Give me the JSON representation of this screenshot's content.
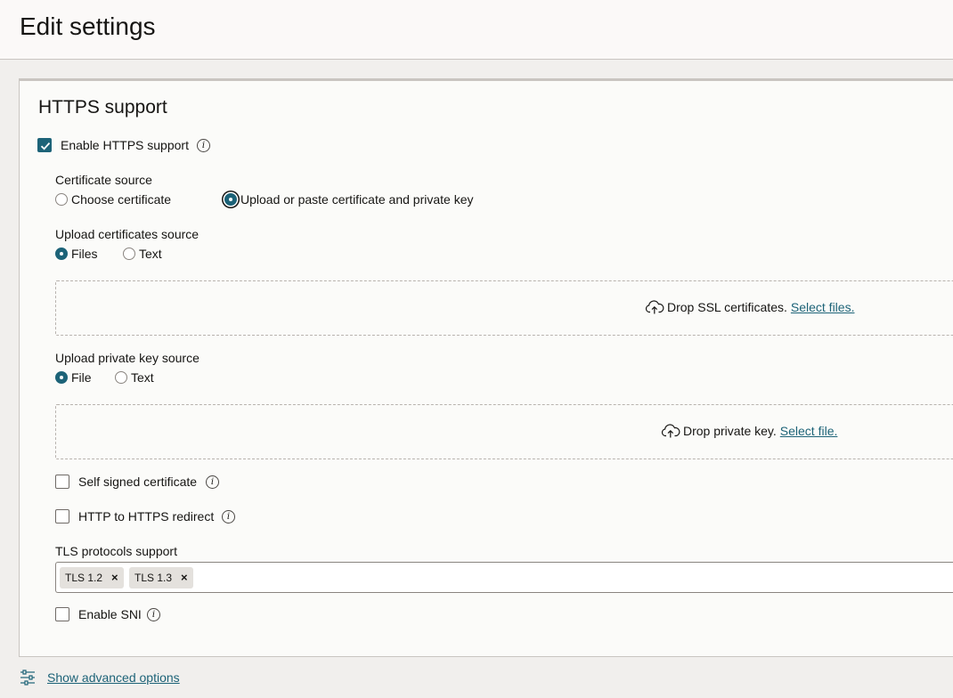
{
  "page": {
    "title": "Edit settings"
  },
  "section": {
    "title": "HTTPS support",
    "enable_https": {
      "label": "Enable HTTPS support",
      "checked": true
    }
  },
  "certificate_source": {
    "label": "Certificate source",
    "options": [
      "Choose certificate",
      "Upload or paste certificate and private key"
    ],
    "selected": "Upload or paste certificate and private key"
  },
  "upload_certificates_source": {
    "label": "Upload certificates source",
    "options": [
      "Files",
      "Text"
    ],
    "selected": "Files"
  },
  "ssl_dropzone": {
    "text": "Drop SSL certificates.",
    "link": "Select files."
  },
  "upload_private_key_source": {
    "label": "Upload private key source",
    "options": [
      "File",
      "Text"
    ],
    "selected": "File"
  },
  "key_dropzone": {
    "text": "Drop private key.",
    "link": "Select file."
  },
  "self_signed": {
    "label": "Self signed certificate",
    "checked": false
  },
  "http_redirect": {
    "label": "HTTP to HTTPS redirect",
    "checked": false
  },
  "tls": {
    "label": "TLS protocols support",
    "chips": [
      "TLS 1.2",
      "TLS 1.3"
    ],
    "remove_glyph": "×"
  },
  "enable_sni": {
    "label": "Enable SNI",
    "checked": false
  },
  "footer": {
    "advanced_link": "Show advanced options"
  },
  "colors": {
    "accent": "#1d6378",
    "background": "#f1efed",
    "panel": "#fbfbf9"
  }
}
